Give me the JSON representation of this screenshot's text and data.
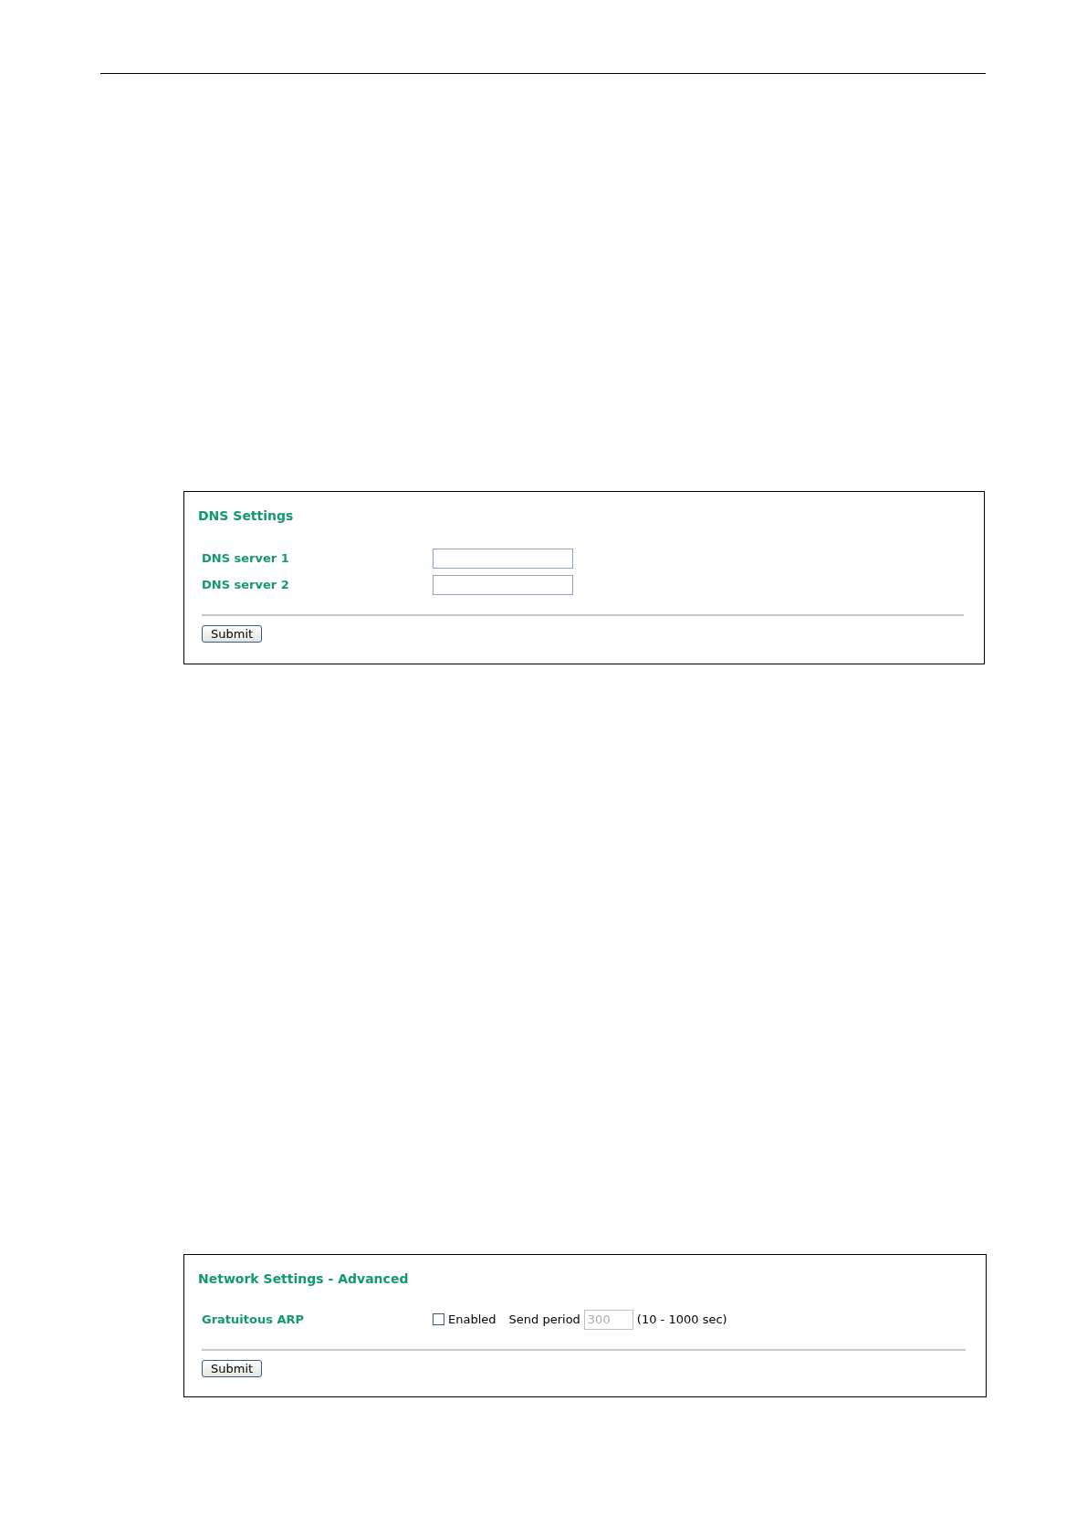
{
  "panels": [
    {
      "title": "DNS Settings",
      "rows": [
        {
          "kind": "text",
          "label": "DNS server 1",
          "value": ""
        },
        {
          "kind": "text",
          "label": "DNS server 2",
          "value": ""
        }
      ],
      "button": "Submit"
    },
    {
      "title": "Network Settings - Advanced",
      "rows": [
        {
          "kind": "arp",
          "label": "Gratuitous ARP",
          "checkbox": {
            "label": "Enabled",
            "checked": false
          },
          "period_label": "Send period",
          "period": {
            "value": "300",
            "disabled": true
          },
          "range": "(10 - 1000 sec)"
        }
      ],
      "button": "Submit"
    }
  ]
}
